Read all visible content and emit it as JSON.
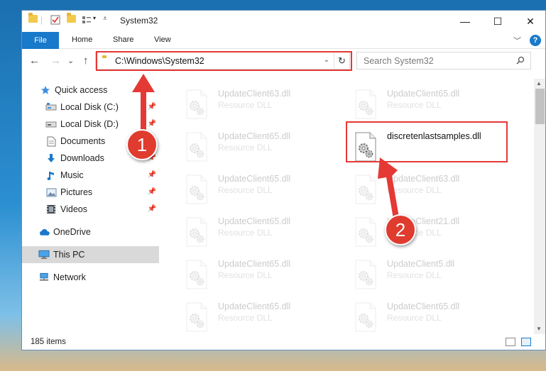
{
  "window": {
    "title": "System32"
  },
  "titlebar": {
    "minimize": "—",
    "maximize": "☐",
    "close": "✕"
  },
  "ribbon": {
    "tabs": [
      "File",
      "Home",
      "Share",
      "View"
    ],
    "expand": "﹀",
    "help": "?"
  },
  "nav": {
    "back": "←",
    "forward": "→",
    "recent": "⌄",
    "up": "↑",
    "address": "C:\\Windows\\System32",
    "address_dropdown": "⌄",
    "refresh": "↻",
    "search_placeholder": "Search System32"
  },
  "sidebar": {
    "items": [
      {
        "label": "Quick access",
        "icon": "star-icon"
      },
      {
        "label": "Local Disk (C:)",
        "icon": "drive-icon",
        "pinned": true
      },
      {
        "label": "Local Disk (D:)",
        "icon": "drive-icon",
        "pinned": true
      },
      {
        "label": "Documents",
        "icon": "documents-icon",
        "pinned": true
      },
      {
        "label": "Downloads",
        "icon": "download-icon",
        "pinned": true
      },
      {
        "label": "Music",
        "icon": "music-icon",
        "pinned": true
      },
      {
        "label": "Pictures",
        "icon": "pictures-icon",
        "pinned": true
      },
      {
        "label": "Videos",
        "icon": "videos-icon",
        "pinned": true
      },
      {
        "label": "OneDrive",
        "icon": "cloud-icon"
      },
      {
        "label": "This PC",
        "icon": "pc-icon",
        "selected": true
      },
      {
        "label": "Network",
        "icon": "network-icon"
      }
    ]
  },
  "files": {
    "left": [
      {
        "name": "UpdateClient63.dll",
        "type": "Resource DLL"
      },
      {
        "name": "UpdateClient65.dll",
        "type": "Resource DLL"
      },
      {
        "name": "UpdateClient65.dll",
        "type": "Resource DLL"
      },
      {
        "name": "UpdateClient65.dll",
        "type": "Resource DLL"
      },
      {
        "name": "UpdateClient65.dll",
        "type": "Resource DLL"
      },
      {
        "name": "UpdateClient65.dll",
        "type": "Resource DLL"
      }
    ],
    "right": [
      {
        "name": "UpdateClient65.dll",
        "type": "Resource DLL"
      },
      {
        "name": "discretenlastsamples.dll",
        "type": "",
        "highlighted": true
      },
      {
        "name": "UpdateClient63.dll",
        "type": "Resource DLL"
      },
      {
        "name": "UpdateClient21.dll",
        "type": "Resource DLL"
      },
      {
        "name": "UpdateClient5.dll",
        "type": "Resource DLL"
      },
      {
        "name": "UpdateClient65.dll",
        "type": "Resource DLL"
      }
    ]
  },
  "status": {
    "item_count": "185 items"
  },
  "annotations": {
    "step1": "1",
    "step2": "2",
    "color": "#e53935"
  }
}
